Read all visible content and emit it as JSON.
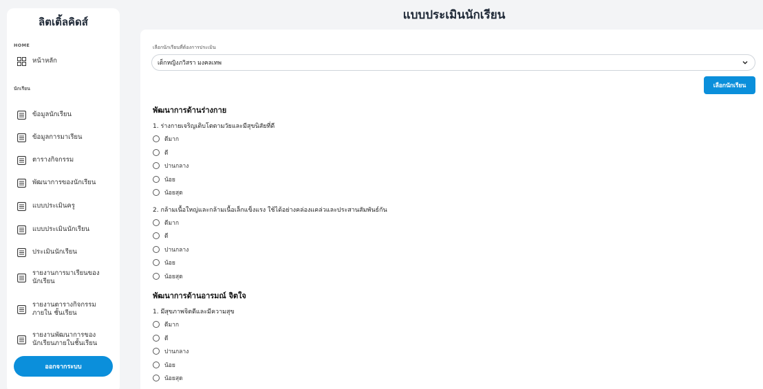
{
  "sidebar": {
    "brand": "ลิตเติ้ลคิดส์",
    "home_label": "HOME",
    "home_item": "หน้าหลัก",
    "student_label": "นักเรียน",
    "items": [
      {
        "label": "ข้อมูลนักเรียน",
        "icon": "list-icon"
      },
      {
        "label": "ข้อมูลการมาเรียน",
        "icon": "list-icon"
      },
      {
        "label": "ตารางกิจกรรม",
        "icon": "list-icon"
      },
      {
        "label": "พัฒนาการของนักเรียน",
        "icon": "list-icon"
      },
      {
        "label": "แบบประเมินครู",
        "icon": "list-icon"
      },
      {
        "label": "แบบประเมินนักเรียน",
        "icon": "list-icon"
      },
      {
        "label": "ประเมินนักเรียน",
        "icon": "list-icon"
      },
      {
        "label": "รายงานการมาเรียนของ นักเรียน",
        "icon": "list-icon"
      },
      {
        "label": "รายงานตารางกิจกรรมภายใน ชั้นเรียน",
        "icon": "list-icon"
      },
      {
        "label": "รายงานพัฒนาการของ นักเรียนภายในชั้นเรียน",
        "icon": "list-icon"
      }
    ],
    "logout": "ออกจากระบบ"
  },
  "page_title": "แบบประเมินนักเรียน",
  "form": {
    "select_label": "เลือกนักเรียนที่ต้องการประเมิน",
    "selected_student": "เด็กหญิงภวิสรา มงคลเทพ",
    "pick_button": "เลือกนักเรียน",
    "options": [
      "ดีมาก",
      "ดี",
      "ปานกลาง",
      "น้อย",
      "น้อยสุด"
    ],
    "sections": [
      {
        "title": "พัฒนาการด้านร่างกาย",
        "questions": [
          "1. ร่างกายเจริญเติบโตตามวัยและมีสุขนิสัยที่ดี",
          "2. กล้ามเนื้อใหญ่และกล้ามเนื้อเล็กแข็งแรง ใช้ได้อย่างคล่องแคล่วและประสานสัมพันธ์กัน"
        ]
      },
      {
        "title": "พัฒนาการด้านอารมณ์ จิตใจ",
        "questions": [
          "1. มีสุขภาพจิตดีและมีความสุข"
        ]
      }
    ]
  },
  "colors": {
    "accent": "#0b8fdb",
    "background": "#f3f4f6",
    "panel": "#ffffff"
  }
}
